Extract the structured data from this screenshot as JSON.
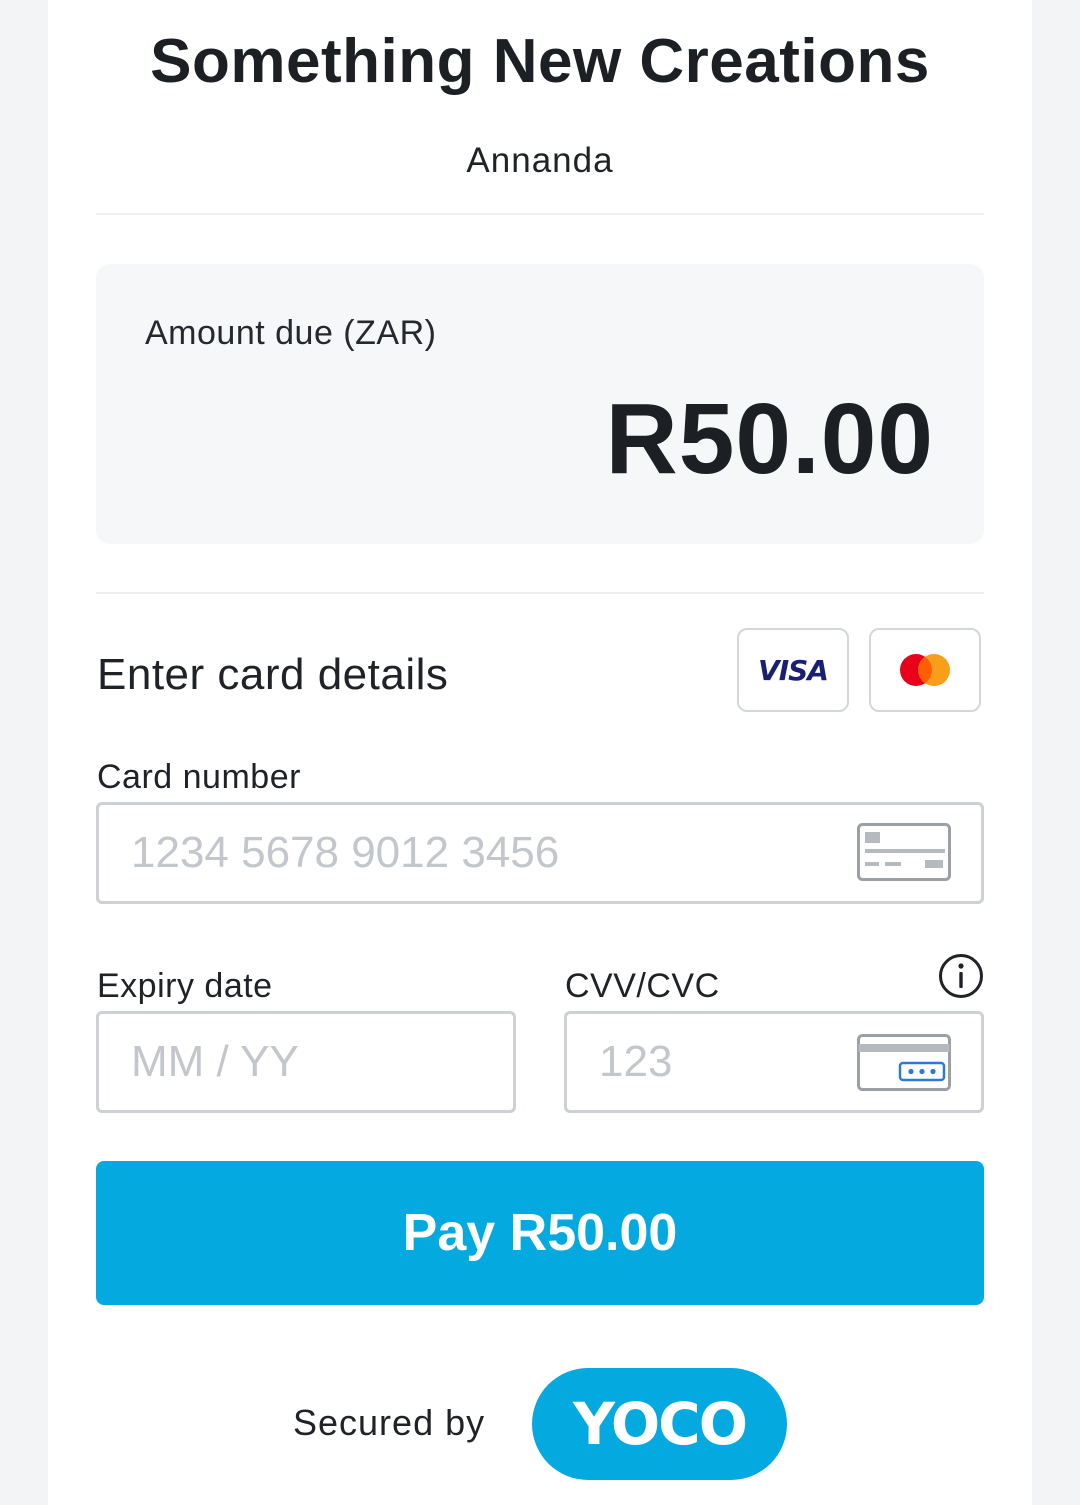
{
  "merchant": {
    "name": "Something New Creations",
    "sub_name": "Annanda"
  },
  "amount": {
    "label": "Amount due (ZAR)",
    "value": "R50.00"
  },
  "card_section": {
    "title": "Enter card details",
    "brands": [
      "VISA",
      "mastercard"
    ],
    "visa_text": "VISA"
  },
  "card_number": {
    "label": "Card number",
    "placeholder": "1234 5678 9012 3456",
    "icon": "credit-card-icon"
  },
  "expiry": {
    "label": "Expiry date",
    "placeholder": "MM / YY"
  },
  "cvv": {
    "label": "CVV/CVC",
    "placeholder": "123",
    "icon": "card-back-cvv-icon",
    "info_icon": "info-icon"
  },
  "pay_button": {
    "label": "Pay R50.00"
  },
  "footer": {
    "secured_label": "Secured by",
    "brand": "YOCO"
  },
  "colors": {
    "accent": "#04a9e0",
    "background": "#f3f4f6",
    "panel": "#ffffff",
    "amount_box": "#f6f7f8",
    "input_border": "#cdd1d5",
    "placeholder": "#c3c7cc",
    "mastercard_red": "#eb001b",
    "mastercard_orange": "#f79e1b",
    "visa_blue": "#1a1f71"
  }
}
